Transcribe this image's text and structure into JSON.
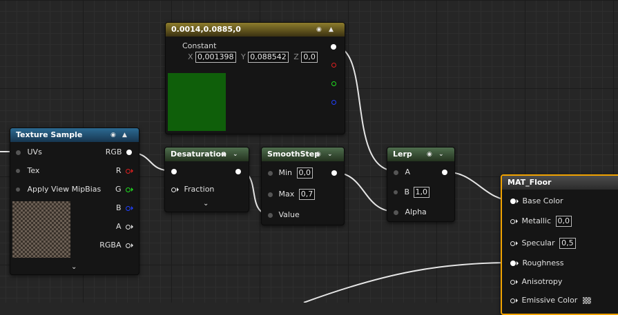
{
  "texture_sample": {
    "title": "Texture Sample",
    "inputs": [
      "UVs",
      "Tex",
      "Apply View MipBias"
    ],
    "outputs": [
      "RGB",
      "R",
      "G",
      "B",
      "A",
      "RGBA"
    ]
  },
  "constant3": {
    "title": "0.0014,0.0885,0",
    "param_label": "Constant",
    "x_label": "X",
    "x_value": "0,001398",
    "y_label": "Y",
    "y_value": "0,088542",
    "z_label": "Z",
    "z_value": "0,0",
    "preview_color": "#0f5f0a"
  },
  "desaturation": {
    "title": "Desaturation",
    "inputs": [
      "Fraction"
    ]
  },
  "smoothstep": {
    "title": "SmoothStep",
    "min_label": "Min",
    "min_value": "0,0",
    "max_label": "Max",
    "max_value": "0,7",
    "value_label": "Value"
  },
  "lerp": {
    "title": "Lerp",
    "a_label": "A",
    "b_label": "B",
    "b_value": "1,0",
    "alpha_label": "Alpha"
  },
  "material": {
    "title": "MAT_Floor",
    "base_color": "Base Color",
    "metallic": "Metallic",
    "metallic_value": "0,0",
    "specular": "Specular",
    "specular_value": "0,5",
    "roughness": "Roughness",
    "anisotropy": "Anisotropy",
    "emissive": "Emissive Color"
  },
  "colors": {
    "selection": "#f2a300",
    "texture_header": "#2c6a92",
    "constant_header": "#8d7c2c",
    "function_header": "#4f6e4e"
  }
}
